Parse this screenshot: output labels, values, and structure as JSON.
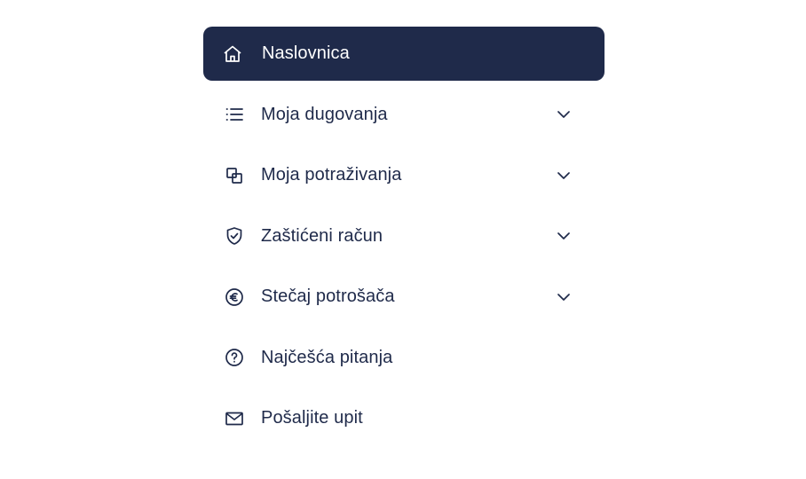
{
  "menu": {
    "items": [
      {
        "label": "Naslovnica",
        "icon": "home-icon",
        "active": true,
        "expandable": false
      },
      {
        "label": "Moja dugovanja",
        "icon": "list-icon",
        "active": false,
        "expandable": true
      },
      {
        "label": "Moja potraživanja",
        "icon": "copy-icon",
        "active": false,
        "expandable": true
      },
      {
        "label": "Zaštićeni račun",
        "icon": "shield-check-icon",
        "active": false,
        "expandable": true
      },
      {
        "label": "Stečaj potrošača",
        "icon": "euro-icon",
        "active": false,
        "expandable": true
      },
      {
        "label": "Najčešća pitanja",
        "icon": "question-icon",
        "active": false,
        "expandable": false
      },
      {
        "label": "Pošaljite upit",
        "icon": "mail-icon",
        "active": false,
        "expandable": false
      }
    ]
  },
  "colors": {
    "active_bg": "#1f2a4a",
    "text": "#1f2a4a",
    "active_text": "#ffffff"
  }
}
